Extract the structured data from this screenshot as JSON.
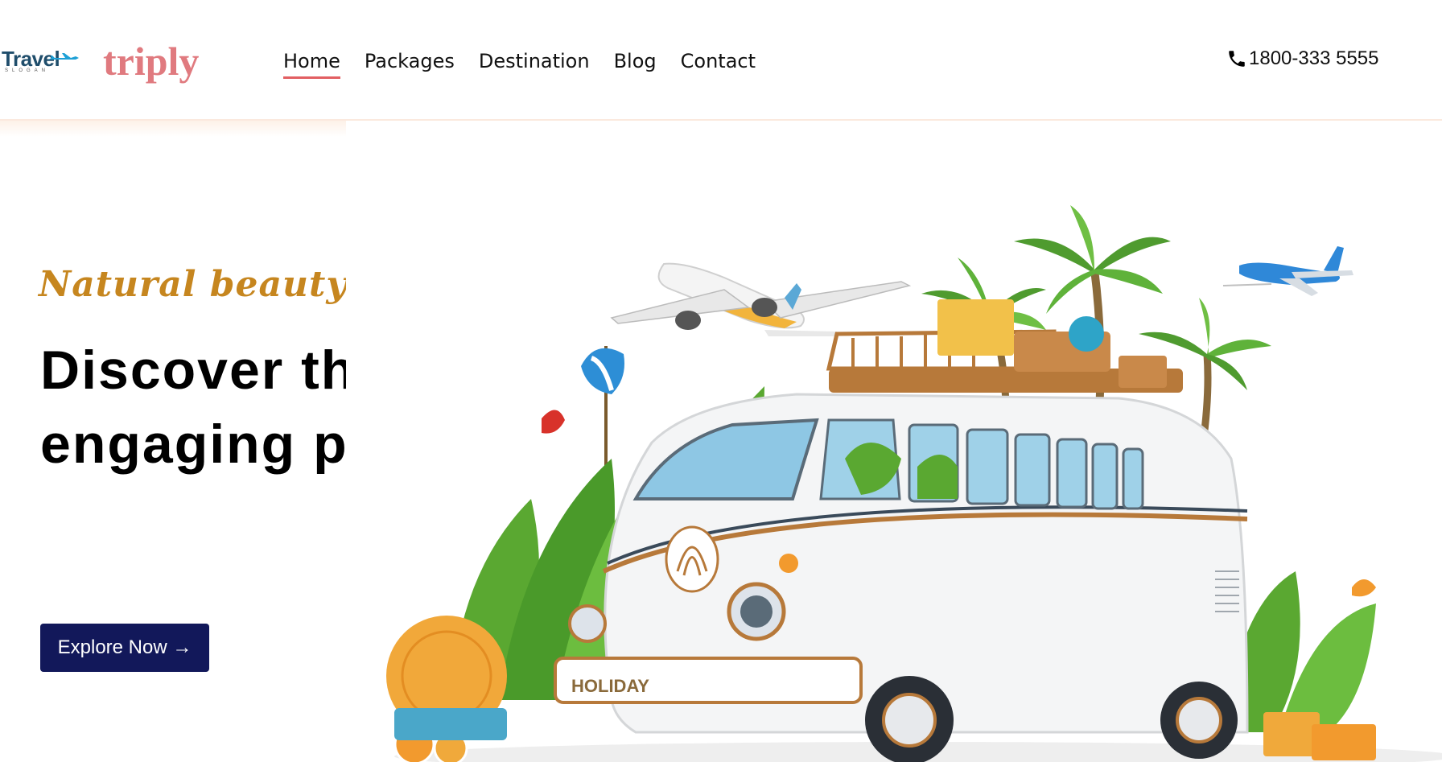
{
  "logo": {
    "word": "Travel",
    "slogan": "SLOGAN"
  },
  "brand": "triply",
  "nav": {
    "items": [
      {
        "label": "Home",
        "active": true
      },
      {
        "label": "Packages",
        "active": false
      },
      {
        "label": "Destination",
        "active": false
      },
      {
        "label": "Blog",
        "active": false
      },
      {
        "label": "Contact",
        "active": false
      }
    ]
  },
  "phone": {
    "icon": "phone-icon",
    "number": "1800-333 5555"
  },
  "hero": {
    "tagline": "Natural beauty",
    "headline_line1": "Discover the most",
    "headline_line2": "engaging places",
    "cta": "Explore Now →",
    "van_plate": "HOLIDAY"
  },
  "colors": {
    "brand": "#e07a7f",
    "nav_active_underline": "#e25f62",
    "tagline": "#c6861f",
    "cta_bg": "#12185a"
  }
}
